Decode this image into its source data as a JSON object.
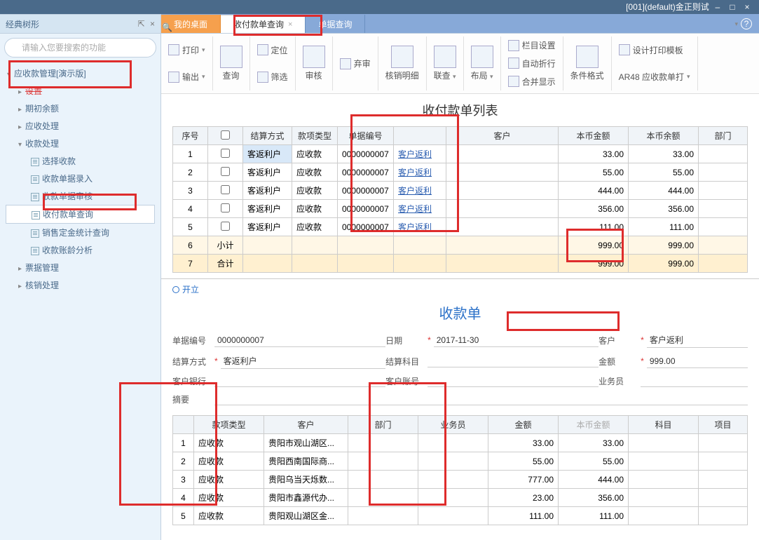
{
  "titlebar": {
    "text": "[001](default)金正则试"
  },
  "sidebar": {
    "title": "经典树形",
    "search_placeholder": "请输入您要搜索的功能",
    "tree": {
      "root": "应收款管理[演示版]",
      "n_setup": "设置",
      "n_qichu": "期初余额",
      "n_yingshou": "应收处理",
      "n_shoukuan": "收款处理",
      "n_xuanze": "选择收款",
      "n_luru": "收款单据录入",
      "n_shenhe": "收款单据审核",
      "n_chaxun": "收付款单查询",
      "n_tongji": "销售定金统计查询",
      "n_zhangling": "收款账龄分析",
      "n_piaoju": "票据管理",
      "n_hexiao": "核销处理"
    }
  },
  "tabs": {
    "t1": "我的桌面",
    "t2": "收付款单查询",
    "t3": "单据查询"
  },
  "ribbon": {
    "print": "打印",
    "export": "输出",
    "query": "查询",
    "locate": "定位",
    "filter": "筛选",
    "audit": "审核",
    "abandon": "弃审",
    "hxmx": "核销明细",
    "liancha": "联查",
    "buju": "布局",
    "lanmu": "栏目设置",
    "zhehang": "自动折行",
    "hebing": "合并显示",
    "tiaojian": "条件格式",
    "dayin": "设计打印模板",
    "ar48": "AR48 应收款单打"
  },
  "list": {
    "title": "收付款单列表",
    "headers": {
      "xuhao": "序号",
      "jsfs": "结算方式",
      "kxlx": "款项类型",
      "djbh": "单据编号",
      "kehu": "客户",
      "bbje": "本币金额",
      "bbye": "本币余额",
      "bumen": "部门"
    },
    "rows": [
      {
        "i": "1",
        "jsfs": "客返利户",
        "kxlx": "应收款",
        "djbh": "0000000007",
        "link": "客户返利",
        "bbje": "33.00",
        "bbye": "33.00"
      },
      {
        "i": "2",
        "jsfs": "客返利户",
        "kxlx": "应收款",
        "djbh": "0000000007",
        "link": "客户返利",
        "bbje": "55.00",
        "bbye": "55.00"
      },
      {
        "i": "3",
        "jsfs": "客返利户",
        "kxlx": "应收款",
        "djbh": "0000000007",
        "link": "客户返利",
        "bbje": "444.00",
        "bbye": "444.00"
      },
      {
        "i": "4",
        "jsfs": "客返利户",
        "kxlx": "应收款",
        "djbh": "0000000007",
        "link": "客户返利",
        "bbje": "356.00",
        "bbye": "356.00"
      },
      {
        "i": "5",
        "jsfs": "客返利户",
        "kxlx": "应收款",
        "djbh": "0000000007",
        "link": "客户返利",
        "bbje": "111.00",
        "bbye": "111.00"
      }
    ],
    "subtotal": {
      "i": "6",
      "label": "小计",
      "bbje": "999.00",
      "bbye": "999.00"
    },
    "total": {
      "i": "7",
      "label": "合计",
      "bbje": "999.00",
      "bbye": "999.00"
    }
  },
  "detail": {
    "status": "开立",
    "title": "收款单",
    "labels": {
      "djbh": "单据编号",
      "riqi": "日期",
      "kehu": "客户",
      "jsfs": "结算方式",
      "jskm": "结算科目",
      "jine": "金额",
      "khyh": "客户银行",
      "khzh": "客户账号",
      "ywy": "业务员",
      "zhaiyao": "摘要"
    },
    "fields": {
      "djbh": "0000000007",
      "riqi": "2017-11-30",
      "kehu": "客户返利",
      "jsfs": "客返利户",
      "jine": "999.00",
      "jskm": "",
      "khyh": "",
      "khzh": "",
      "ywy": "",
      "zhaiyao": ""
    },
    "grid_headers": {
      "kxlx": "款项类型",
      "kehu": "客户",
      "bumen": "部门",
      "ywy": "业务员",
      "jine": "金额",
      "bbje": "本币金额",
      "kemu": "科目",
      "xiangmu": "项目"
    },
    "grid_rows": [
      {
        "i": "1",
        "kxlx": "应收款",
        "kehu": "贵阳市观山湖区...",
        "jine": "33.00",
        "bbje": "33.00"
      },
      {
        "i": "2",
        "kxlx": "应收款",
        "kehu": "贵阳西南国际商...",
        "jine": "55.00",
        "bbje": "55.00"
      },
      {
        "i": "3",
        "kxlx": "应收款",
        "kehu": "贵阳乌当天烁数...",
        "jine": "777.00",
        "bbje": "444.00"
      },
      {
        "i": "4",
        "kxlx": "应收款",
        "kehu": "贵阳市鑫源代办...",
        "jine": "23.00",
        "bbje": "356.00"
      },
      {
        "i": "5",
        "kxlx": "应收款",
        "kehu": "贵阳观山湖区金...",
        "jine": "111.00",
        "bbje": "111.00"
      }
    ]
  }
}
